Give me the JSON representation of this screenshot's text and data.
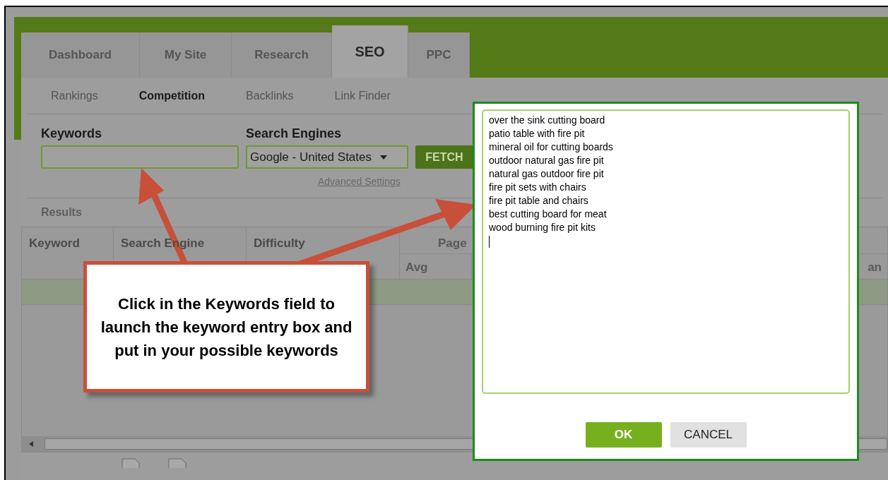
{
  "tabs": [
    {
      "label": "Dashboard",
      "selected": false
    },
    {
      "label": "My Site",
      "selected": false
    },
    {
      "label": "Research",
      "selected": false
    },
    {
      "label": "SEO",
      "selected": true
    },
    {
      "label": "PPC",
      "selected": false
    }
  ],
  "subtabs": [
    {
      "label": "Rankings",
      "selected": false
    },
    {
      "label": "Competition",
      "selected": true
    },
    {
      "label": "Backlinks",
      "selected": false
    },
    {
      "label": "Link Finder",
      "selected": false
    }
  ],
  "form": {
    "keywords_label": "Keywords",
    "engines_label": "Search Engines",
    "engine_value": "Google - United States",
    "fetch_button": "FETCH",
    "advanced_link": "Advanced Settings"
  },
  "results": {
    "title": "Results",
    "columns": [
      "Keyword",
      "Search Engine",
      "Difficulty"
    ],
    "group_column": "Page",
    "sub_column": "Avg",
    "cut_column": "an"
  },
  "callout": "Click in the Keywords field to launch the keyword entry box and put in your possible keywords",
  "dialog": {
    "keywords": [
      "over the sink cutting board",
      "patio table with fire pit",
      "mineral oil for cutting boards",
      "outdoor natural gas fire pit",
      "natural gas outdoor fire pit",
      "fire pit sets with chairs",
      "fire pit table and chairs",
      "best cutting board for meat",
      "wood burning fire pit kits"
    ],
    "ok_button": "OK",
    "cancel_button": "CANCEL"
  }
}
